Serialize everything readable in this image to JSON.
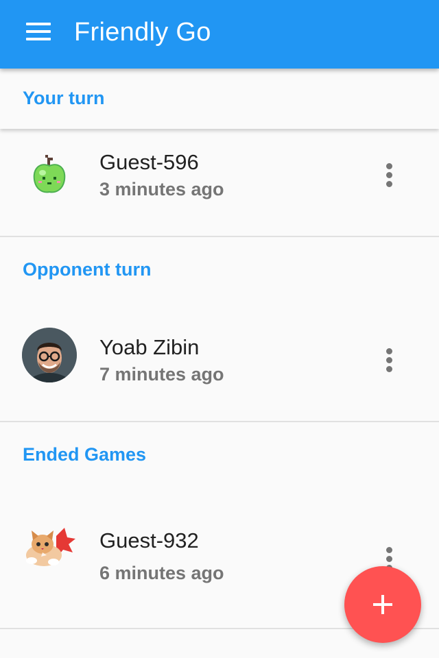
{
  "app": {
    "title": "Friendly Go",
    "primary_color": "#2196f3",
    "accent_color": "#ff5252"
  },
  "toolbar": {
    "menu_icon": "hamburger-menu-icon"
  },
  "sections": [
    {
      "label": "Your turn",
      "games": [
        {
          "player": "Guest-596",
          "time": "3 minutes ago",
          "avatar": "green-apple-avatar",
          "menu_icon": "more-vert-icon"
        }
      ]
    },
    {
      "label": "Opponent turn",
      "games": [
        {
          "player": "Yoab Zibin",
          "time": "7 minutes ago",
          "avatar": "user-photo-avatar",
          "menu_icon": "more-vert-icon"
        }
      ]
    },
    {
      "label": "Ended Games",
      "games": [
        {
          "player": "Guest-932",
          "time": "6 minutes ago",
          "avatar": "kitten-avatar",
          "menu_icon": "more-vert-icon"
        }
      ]
    }
  ],
  "fab": {
    "icon": "plus-icon",
    "action": "new-game"
  }
}
